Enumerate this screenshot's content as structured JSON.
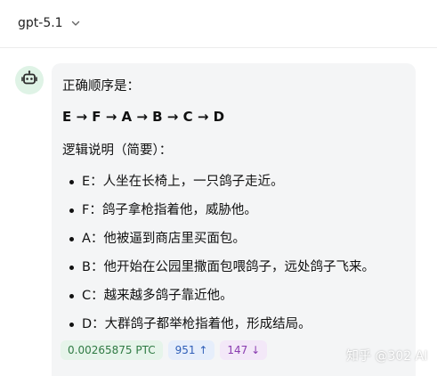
{
  "header": {
    "model_name": "gpt-5.1",
    "chevron_icon": "chevron-down-icon"
  },
  "message": {
    "avatar_icon": "robot-icon",
    "avatar_bg": "#dff3e6",
    "intro": "正确顺序是：",
    "sequence": "E → F → A → B → C → D",
    "explanation_title": "逻辑说明（简要）：",
    "items": [
      "E：人坐在长椅上，一只鸽子走近。",
      "F：鸽子拿枪指着他，威胁他。",
      "A：他被逼到商店里买面包。",
      "B：他开始在公园里撒面包喂鸽子，远处鸽子飞来。",
      "C：越来越多鸽子靠近他。",
      "D：大群鸽子都举枪指着他，形成结局。"
    ]
  },
  "meta": {
    "cost": "0.00265875 PTC",
    "tokens_up": "951 ↑",
    "tokens_down": "147 ↓"
  },
  "watermark": "知乎 @302 AI"
}
